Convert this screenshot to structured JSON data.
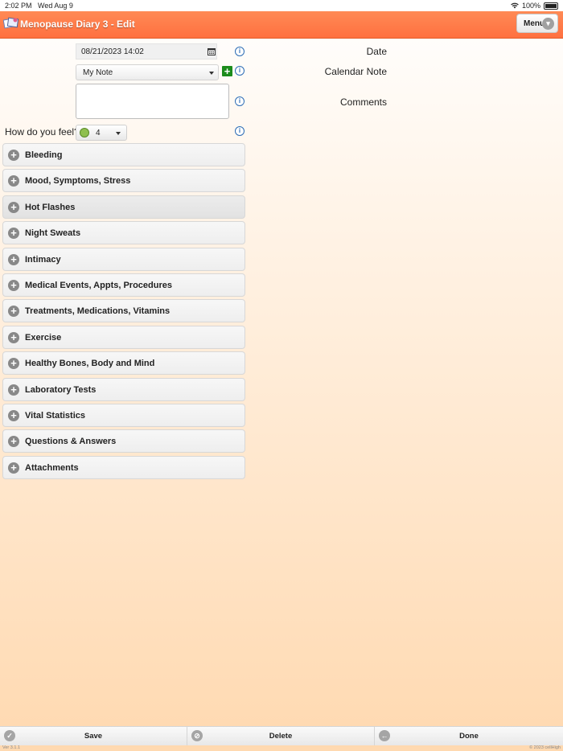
{
  "statusbar": {
    "time": "2:02 PM",
    "date": "Wed Aug 9",
    "battery": "100%"
  },
  "header": {
    "title": "Menopause Diary 3 - Edit",
    "menu_label": "Menu"
  },
  "form": {
    "date_label": "Date",
    "date_value": "08/21/2023 14:02",
    "calendar_note_label": "Calendar Note",
    "calendar_note_value": "My Note",
    "comments_label": "Comments",
    "feel_label": "How do you feel?",
    "feel_value": "4"
  },
  "sections": [
    {
      "label": "Bleeding"
    },
    {
      "label": "Mood, Symptoms, Stress"
    },
    {
      "label": "Hot Flashes"
    },
    {
      "label": "Night Sweats"
    },
    {
      "label": "Intimacy"
    },
    {
      "label": "Medical Events, Appts, Procedures"
    },
    {
      "label": "Treatments, Medications, Vitamins"
    },
    {
      "label": "Exercise"
    },
    {
      "label": "Healthy Bones, Body and Mind"
    },
    {
      "label": "Laboratory Tests"
    },
    {
      "label": "Vital Statistics"
    },
    {
      "label": "Questions & Answers"
    },
    {
      "label": "Attachments"
    }
  ],
  "footer": {
    "save": "Save",
    "delete": "Delete",
    "done": "Done"
  },
  "bottom": {
    "version": "Ver 3.1.1",
    "copyright": "© 2023 cellHigh"
  },
  "colors": {
    "header": "#ff7a48",
    "add_button": "#1c8c1c",
    "info": "#2c6cb5"
  }
}
